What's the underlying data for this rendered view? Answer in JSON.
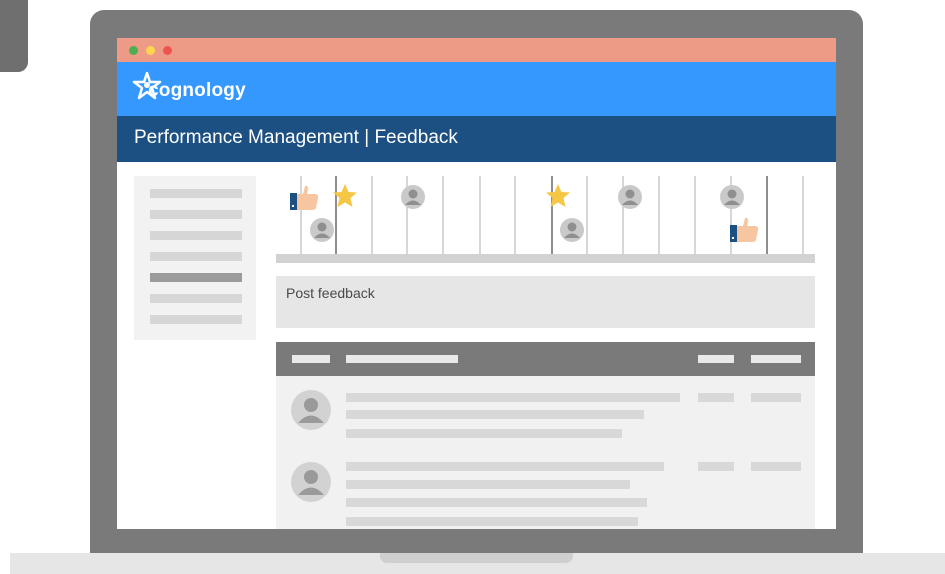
{
  "window": {
    "title_dots": [
      "#4caf50",
      "#ffd54f",
      "#ef5350"
    ]
  },
  "brand": {
    "name": "cognology",
    "logo_icon": "star-person-logo-icon",
    "color": "#3598fe"
  },
  "page": {
    "title": "Performance Management | Feedback"
  },
  "timeline": {
    "icons": [
      "thumbs-up-icon",
      "star-icon",
      "user-avatar-icon",
      "user-avatar-icon",
      "star-icon",
      "user-avatar-icon",
      "user-avatar-icon",
      "user-avatar-icon",
      "thumbs-up-icon"
    ]
  },
  "feedback": {
    "post_label": "Post feedback"
  },
  "colors": {
    "titlebar": "#ed9a86",
    "header": "#1c4f82",
    "star": "#f6c744"
  }
}
